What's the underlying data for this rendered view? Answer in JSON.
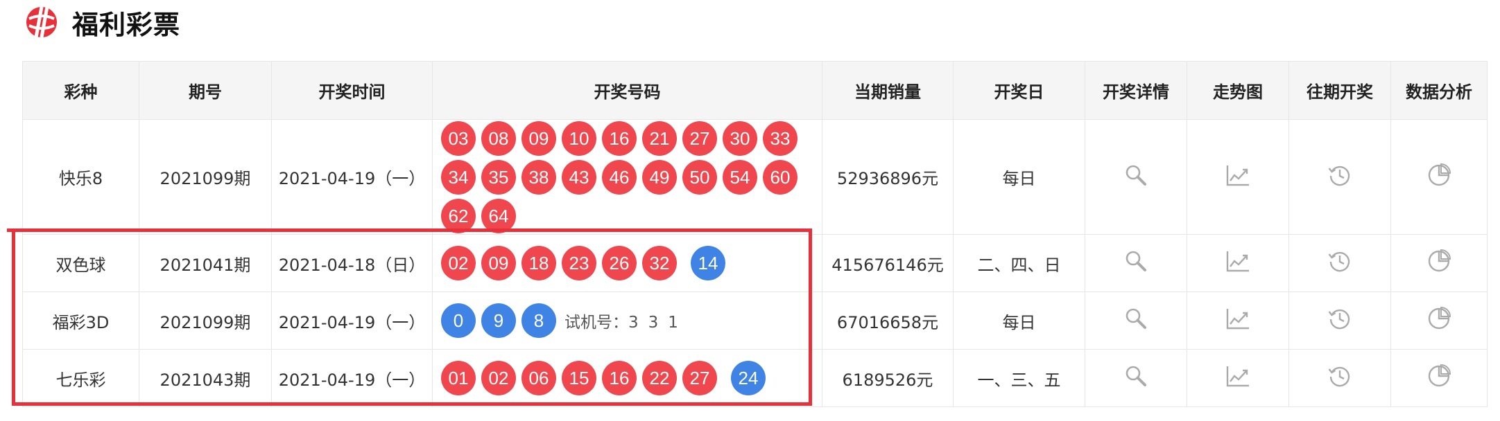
{
  "header": {
    "logo_text": "福利彩票",
    "brand_color": "#e8303a"
  },
  "table": {
    "columns": [
      "彩种",
      "期号",
      "开奖时间",
      "开奖号码",
      "当期销量",
      "开奖日",
      "开奖详情",
      "走势图",
      "往期开奖",
      "数据分析"
    ],
    "rows": [
      {
        "key": "kl8",
        "name": "快乐8",
        "issue": "2021099期",
        "date": "2021-04-19（一）",
        "red": [
          "03",
          "08",
          "09",
          "10",
          "16",
          "21",
          "27",
          "30",
          "33",
          "34",
          "35",
          "38",
          "43",
          "46",
          "49",
          "50",
          "54",
          "60",
          "62",
          "64"
        ],
        "blue": [],
        "trial_label": "",
        "trial": [],
        "sales": "52936896元",
        "draw_days": "每日"
      },
      {
        "key": "ssq",
        "name": "双色球",
        "issue": "2021041期",
        "date": "2021-04-18（日）",
        "red": [
          "02",
          "09",
          "18",
          "23",
          "26",
          "32"
        ],
        "blue": [
          "14"
        ],
        "trial_label": "",
        "trial": [],
        "sales": "415676146元",
        "draw_days": "二、四、日"
      },
      {
        "key": "3d",
        "name": "福彩3D",
        "issue": "2021099期",
        "date": "2021-04-19（一）",
        "red": [],
        "blue": [
          "0",
          "9",
          "8"
        ],
        "trial_label": "试机号：",
        "trial": [
          "3",
          "3",
          "1"
        ],
        "sales": "67016658元",
        "draw_days": "每日"
      },
      {
        "key": "qlc",
        "name": "七乐彩",
        "issue": "2021043期",
        "date": "2021-04-19（一）",
        "red": [
          "01",
          "02",
          "06",
          "15",
          "16",
          "22",
          "27"
        ],
        "blue": [
          "24"
        ],
        "trial_label": "",
        "trial": [],
        "sales": "6189526元",
        "draw_days": "一、三、五"
      }
    ],
    "action_icons": [
      "search-icon",
      "trend-chart-icon",
      "history-icon",
      "pie-chart-icon"
    ]
  },
  "colors": {
    "red_ball": "#f0474f",
    "blue_ball": "#3f84e5",
    "header_bg": "#f5f5f5",
    "highlight_box": "#e8303a"
  }
}
